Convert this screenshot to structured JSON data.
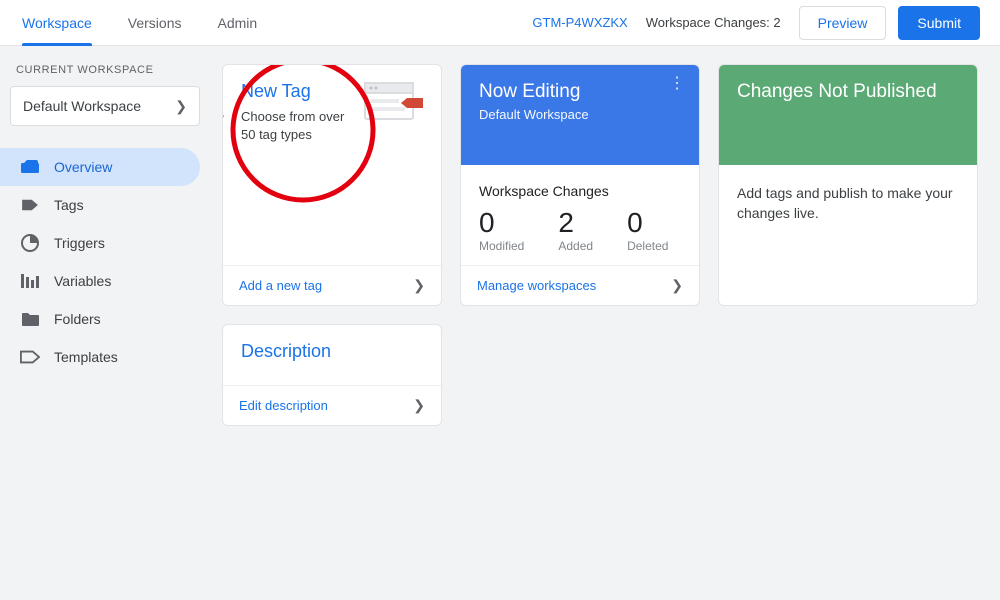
{
  "topbar": {
    "tabs": [
      "Workspace",
      "Versions",
      "Admin"
    ],
    "active_tab": 0,
    "container_id": "GTM-P4WXZKX",
    "changes_label": "Workspace Changes: 2",
    "preview_label": "Preview",
    "submit_label": "Submit"
  },
  "sidebar": {
    "section_label": "CURRENT WORKSPACE",
    "workspace_name": "Default Workspace",
    "items": [
      {
        "label": "Overview"
      },
      {
        "label": "Tags"
      },
      {
        "label": "Triggers"
      },
      {
        "label": "Variables"
      },
      {
        "label": "Folders"
      },
      {
        "label": "Templates"
      }
    ],
    "active_index": 0
  },
  "cards": {
    "new_tag": {
      "title": "New Tag",
      "subtitle": "Choose from over 50 tag types",
      "footer": "Add a new tag"
    },
    "description": {
      "title": "Description",
      "footer": "Edit description"
    },
    "now_editing": {
      "title": "Now Editing",
      "subtitle": "Default Workspace",
      "section_label": "Workspace Changes",
      "stats": [
        {
          "num": "0",
          "label": "Modified"
        },
        {
          "num": "2",
          "label": "Added"
        },
        {
          "num": "0",
          "label": "Deleted"
        }
      ],
      "footer": "Manage workspaces"
    },
    "not_published": {
      "title": "Changes Not Published",
      "body": "Add tags and publish to make your changes live."
    }
  }
}
